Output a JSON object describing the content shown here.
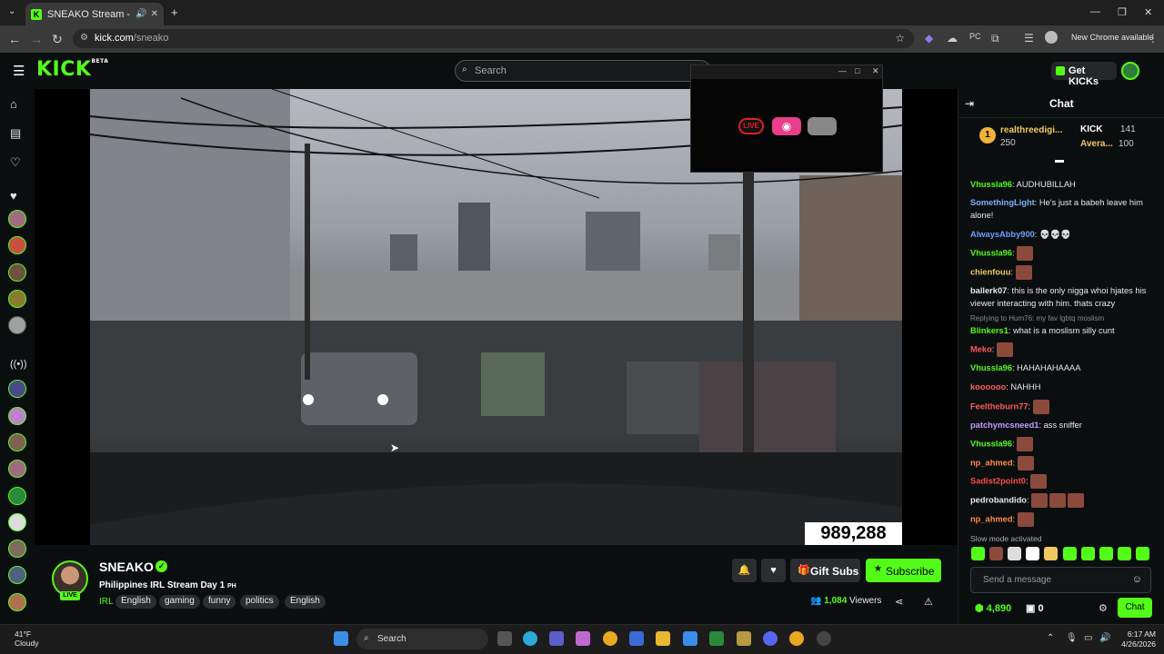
{
  "browser": {
    "tab_title": "SNEAKO Stream - Watch Li",
    "url_host": "kick.com",
    "url_path": "/sneako",
    "new_chrome": "New Chrome available"
  },
  "header": {
    "logo": "KICK",
    "logo_badge": "BETA",
    "search_placeholder": "Search",
    "get_kicks": "Get KICKs"
  },
  "player": {
    "viewer_overlay": "989,288"
  },
  "channel": {
    "name": "SNEAKO",
    "live_badge": "LIVE",
    "stream_title": "Philippines IRL Stream Day 1",
    "stream_title_suffix": "PH",
    "category": "IRL",
    "tags": [
      "English",
      "gaming",
      "funny",
      "politics",
      "English"
    ],
    "gift_subs": "Gift Subs",
    "subscribe": "Subscribe",
    "viewer_count": "1,084",
    "viewers_label": "Viewers"
  },
  "chat": {
    "title": "Chat",
    "leaderboard": [
      {
        "name": "realthreedigi...",
        "value": "250"
      },
      {
        "name": "KICK",
        "value": "141"
      },
      {
        "name": "Avera...",
        "value": "100"
      }
    ],
    "messages": [
      {
        "user": "Vhussla96",
        "color": "#53fc18",
        "text": "AUDHUBILLAH"
      },
      {
        "user": "SomethingLight",
        "color": "#7fb3ff",
        "text": "He's just a babeh leave him alone!"
      },
      {
        "user": "AlwaysAbby900",
        "color": "#6aa0ff",
        "text": "💀💀💀"
      },
      {
        "user": "Vhussla96",
        "color": "#53fc18",
        "text": ""
      },
      {
        "user": "chienfouu",
        "color": "#f0c860",
        "text": ""
      },
      {
        "user": "ballerk07",
        "color": "#e8e8e8",
        "text": "this is the only nigga whoi hjates his viewer interacting with him. thats crazy"
      },
      {
        "user": "Blinkers1",
        "color": "#53fc18",
        "text": "what is a moslism silly cunt"
      },
      {
        "user": "Meko",
        "color": "#ff5a5a",
        "text": ""
      },
      {
        "user": "Vhussla96",
        "color": "#53fc18",
        "text": "HAHAHAHAAAA"
      },
      {
        "user": "koooooo",
        "color": "#ff5a5a",
        "text": "NAHHH"
      },
      {
        "user": "Feeltheburn77",
        "color": "#ff5a5a",
        "text": ""
      },
      {
        "user": "patchymcsneed1",
        "color": "#c89bff",
        "text": "ass sniffer"
      },
      {
        "user": "Vhussla96",
        "color": "#53fc18",
        "text": ""
      },
      {
        "user": "np_ahmed",
        "color": "#ff8a4a",
        "text": ""
      },
      {
        "user": "Sadist2point0",
        "color": "#ff4a4a",
        "text": ""
      },
      {
        "user": "pedrobandido",
        "color": "#e8e8e8",
        "text": ""
      },
      {
        "user": "np_ahmed",
        "color": "#ff8a4a",
        "text": ""
      }
    ],
    "replying_to": "Replying to Hum76: my fav lgbtq moslism",
    "slow_mode": "Slow mode activated",
    "input_placeholder": "Send a message",
    "kicks_balance": "4,890",
    "chest_balance": "0",
    "chat_button": "Chat"
  },
  "taskbar": {
    "weather_temp": "41°F",
    "weather_desc": "Cloudy",
    "search": "Search",
    "time": "6:17 AM",
    "date": "4/26/2026"
  },
  "colors": {
    "accent": "#53fc18",
    "background": "#0b0e0f"
  }
}
